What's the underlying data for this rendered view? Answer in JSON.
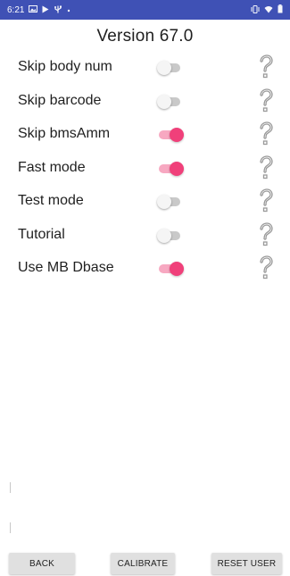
{
  "status_bar": {
    "time": "6:21",
    "left_icons": [
      "gallery-icon",
      "play-store-icon",
      "usb-icon",
      "dot-icon"
    ],
    "right_icons": [
      "vibrate-icon",
      "wifi-icon",
      "battery-icon"
    ],
    "background": "#3f51b5"
  },
  "title": "Version 67.0",
  "settings": [
    {
      "label": "Skip body num",
      "enabled": false
    },
    {
      "label": "Skip barcode",
      "enabled": false
    },
    {
      "label": "Skip bmsAmm",
      "enabled": true
    },
    {
      "label": "Fast mode",
      "enabled": true
    },
    {
      "label": "Test mode",
      "enabled": false
    },
    {
      "label": "Tutorial",
      "enabled": false
    },
    {
      "label": "Use MB Dbase",
      "enabled": true
    }
  ],
  "help_icon": "question-mark-icon",
  "buttons": {
    "back": "BACK",
    "calibrate": "CALIBRATE",
    "reset_user": "RESET USER"
  },
  "colors": {
    "switch_on_thumb": "#f0407a",
    "switch_on_track": "#f7a8c1",
    "switch_off_track": "#c9c9c9",
    "button_bg": "#e0e0e0"
  }
}
